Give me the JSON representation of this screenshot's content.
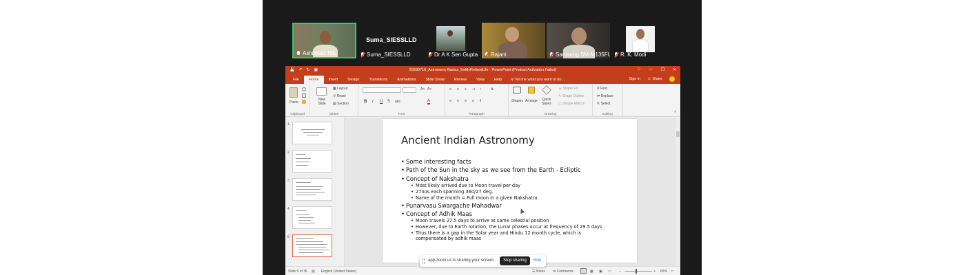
{
  "zoom": {
    "speaker_label": "Suma_SIESSLLD",
    "participants": [
      {
        "name": "Ashirwad Tillu",
        "muted": false,
        "active": true
      },
      {
        "name": "Suma_SIESSLLD",
        "muted": true
      },
      {
        "name": "Dr A K Sen Gupta",
        "muted": true
      },
      {
        "name": "Rajani",
        "muted": true
      },
      {
        "name": "Samsung SM-M135FU",
        "muted": true
      },
      {
        "name": "R. K. Modi",
        "muted": true
      }
    ],
    "share_banner": {
      "message": "app.zoom.us is sharing your screen.",
      "stop_label": "Stop sharing",
      "hide_label": "Hide"
    }
  },
  "powerpoint": {
    "window_title": "20280716_Astronomy Basics_forMyRetiredLife - PowerPoint (Product Activation Failed)",
    "tabs": [
      "File",
      "Home",
      "Insert",
      "Design",
      "Transitions",
      "Animations",
      "Slide Show",
      "Review",
      "View",
      "Help"
    ],
    "active_tab": "Home",
    "tell_me": "Tell me what you want to do...",
    "sign_in": "Sign in",
    "share": "Share",
    "ribbon": {
      "paste": "Paste",
      "clipboard": "Clipboard",
      "new_slide": "New Slide",
      "layout": "Layout",
      "reset": "Reset",
      "section": "Section",
      "slides": "Slides",
      "font": "Font",
      "bold": "B",
      "italic": "I",
      "underline": "U",
      "strike": "S",
      "shadow": "abc",
      "paragraph": "Paragraph",
      "shapes": "Shapes",
      "arrange": "Arrange",
      "quick_styles": "Quick Styles",
      "shape_fill": "Shape Fill",
      "shape_outline": "Shape Outline",
      "shape_effects": "Shape Effects",
      "drawing": "Drawing",
      "find": "Find",
      "replace": "Replace",
      "select": "Select",
      "editing": "Editing"
    },
    "thumbnails": [
      {
        "number": "1"
      },
      {
        "number": "2"
      },
      {
        "number": "3"
      },
      {
        "number": "4"
      },
      {
        "number": "5",
        "selected": true
      }
    ],
    "slide": {
      "title": "Ancient Indian Astronomy",
      "bullets": [
        {
          "level": 1,
          "text": "Some interesting facts"
        },
        {
          "level": 1,
          "text": "Path of the Sun in the sky as we see from the Earth - Ecliptic"
        },
        {
          "level": 1,
          "text": "Concept of Nakshatra"
        },
        {
          "level": 2,
          "text": "Most likely arrived due to Moon travel per day"
        },
        {
          "level": 2,
          "text": "27nos each spanning 360/27 deg."
        },
        {
          "level": 2,
          "text": "Name of the month = Full moon in a given Nakshatra"
        },
        {
          "level": 1,
          "text": "Punarvasu Swargache Mahadwar"
        },
        {
          "level": 1,
          "text": "Concept of Adhik Maas"
        },
        {
          "level": 2,
          "text": "Moon travels 27.5 days to arrive at same celestial position"
        },
        {
          "level": 2,
          "text": "However, due to Earth rotation, the Lunar phases occur at frequency of 29.5 days"
        },
        {
          "level": 2,
          "text": "Thus there is a gap in the Solar year and Hindu 12 month cycle, which is"
        },
        {
          "level": 3,
          "text": "compensated by adhik maas"
        }
      ]
    },
    "status": {
      "slide_info": "Slide 5 of 36",
      "language": "English (United States)",
      "notes": "Notes",
      "comments": "Comments",
      "zoom": "65%"
    }
  },
  "colors": {
    "ppt_accent": "#c43e1c",
    "zoom_bg": "#1a1a1a",
    "active_speaker": "#2ecc71"
  }
}
